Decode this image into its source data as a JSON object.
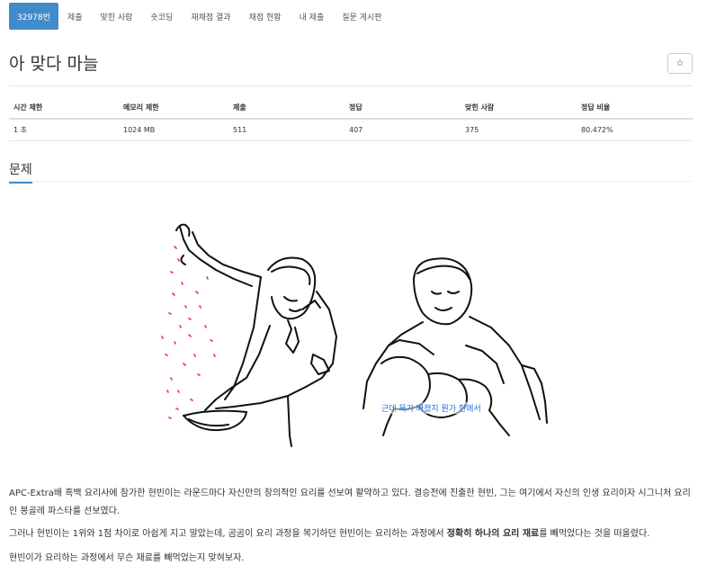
{
  "nav": {
    "problem_number": "32978번",
    "items": [
      "제출",
      "맞힌 사람",
      "숏코딩",
      "재채점 결과",
      "채점 현황",
      "내 제출",
      "질문 게시판"
    ]
  },
  "problem": {
    "title": "아 맞다 마늘",
    "star_icon": "☆"
  },
  "info": {
    "headers": [
      "시간 제한",
      "메모리 제한",
      "제출",
      "정답",
      "맞힌 사람",
      "정답 비율"
    ],
    "values": [
      "1 초",
      "1024 MB",
      "511",
      "407",
      "375",
      "80.472%"
    ]
  },
  "section": {
    "heading": "문제"
  },
  "figure": {
    "caption": "근데 묵가 빠졌지 뭔가 한에서"
  },
  "body": {
    "p1": "APC-Extra배 흑백 요리사에 참가한 현빈이는 라운드마다 자신만의 창의적인 요리를 선보여 활약하고 있다. 결승전에 진출한 현빈, 그는 여기에서 자신의 인생 요리이자 시그니처 요리인 봉골레 파스타를 선보였다.",
    "p2_before": "그러나 현빈이는 1위와 1점 차이로 아쉽게 지고 말았는데, 곰곰이 요리 과정을 복기하던 현빈이는 요리하는 과정에서 ",
    "p2_bold": "정확히 하나의 요리 재료",
    "p2_after": "를 빼먹었다는 것을 떠올렸다.",
    "p3": "현빈이가 요리하는 과정에서 무슨 재료를 빼먹었는지 맞혀보자."
  },
  "colors": {
    "accent": "#428bca",
    "salt": "#e53935",
    "caption": "#1a73e8"
  }
}
